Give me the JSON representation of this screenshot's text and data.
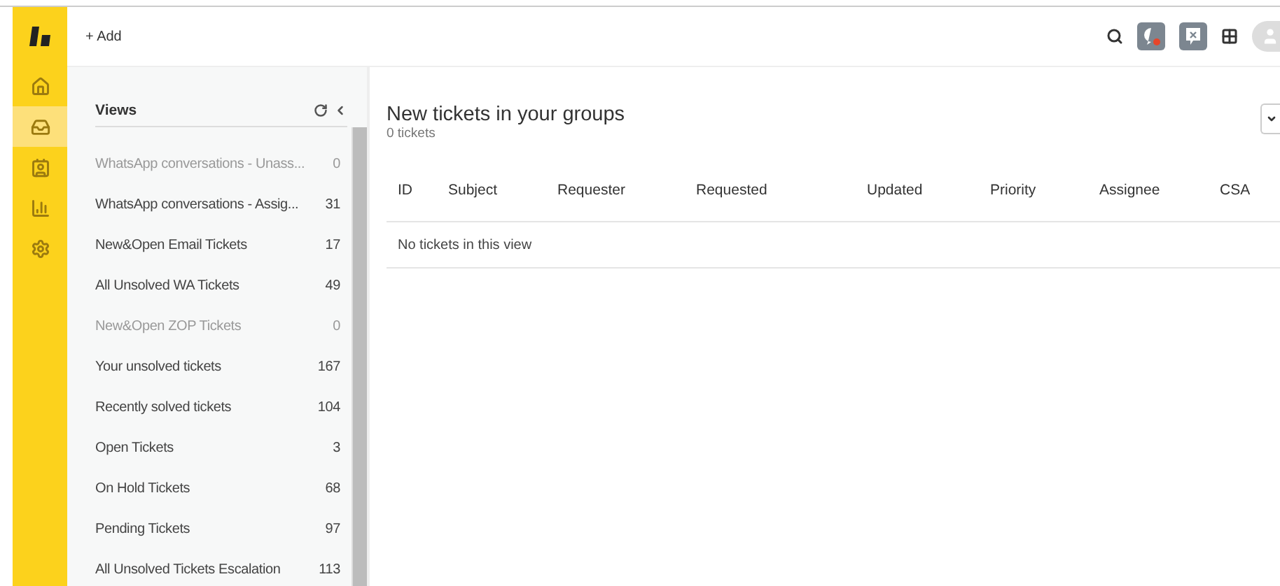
{
  "topbar": {
    "add_label": "+ Add"
  },
  "nav": [
    {
      "kind": "home",
      "selected": false
    },
    {
      "kind": "tickets",
      "selected": true
    },
    {
      "kind": "users",
      "selected": false
    },
    {
      "kind": "reports",
      "selected": false
    },
    {
      "kind": "settings",
      "selected": false
    }
  ],
  "views": {
    "title": "Views",
    "items": [
      {
        "label": "WhatsApp conversations - Unass...",
        "count": "0",
        "disabled": true
      },
      {
        "label": "WhatsApp conversations - Assig...",
        "count": "31",
        "disabled": false
      },
      {
        "label": "New&Open Email Tickets",
        "count": "17",
        "disabled": false
      },
      {
        "label": "All Unsolved WA Tickets",
        "count": "49",
        "disabled": false
      },
      {
        "label": "New&Open ZOP Tickets",
        "count": "0",
        "disabled": true
      },
      {
        "label": "Your unsolved tickets",
        "count": "167",
        "disabled": false
      },
      {
        "label": "Recently solved tickets",
        "count": "104",
        "disabled": false
      },
      {
        "label": "Open Tickets",
        "count": "3",
        "disabled": false
      },
      {
        "label": "On Hold Tickets",
        "count": "68",
        "disabled": false
      },
      {
        "label": "Pending Tickets",
        "count": "97",
        "disabled": false
      },
      {
        "label": "All Unsolved Tickets Escalation",
        "count": "113",
        "disabled": false
      }
    ]
  },
  "main": {
    "title": "New tickets in your groups",
    "subtitle": "0 tickets",
    "table": {
      "columns": [
        "ID",
        "Subject",
        "Requester",
        "Requested",
        "Updated",
        "Priority",
        "Assignee",
        "CSA"
      ],
      "empty_message": "No tickets in this view"
    }
  }
}
